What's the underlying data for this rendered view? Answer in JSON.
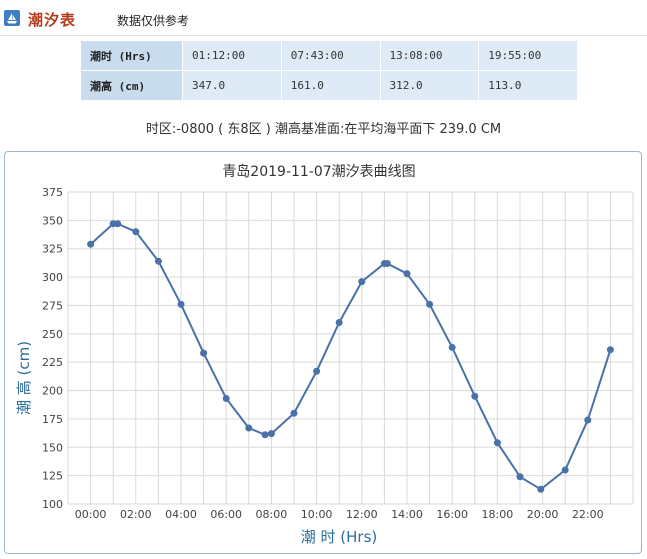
{
  "header": {
    "icon": "ship-icon",
    "title": "潮汐表",
    "note": "数据仅供参考"
  },
  "table": {
    "rows": [
      {
        "label": "潮时 (Hrs)",
        "values": [
          "01:12:00",
          "07:43:00",
          "13:08:00",
          "19:55:00"
        ]
      },
      {
        "label": "潮高 (cm)",
        "values": [
          "347.0",
          "161.0",
          "312.0",
          "113.0"
        ]
      }
    ]
  },
  "info": "时区:-0800 ( 东8区 ) 潮高基准面:在平均海平面下 239.0 CM",
  "colors": {
    "line": "#4a72a8",
    "grid": "#d9d9d9",
    "table_header": "#c9dcee",
    "table_cell": "#deebf7",
    "title_red": "#b63a1c",
    "axis_title": "#2d6e9e"
  },
  "chart_data": {
    "type": "line",
    "title": "青岛2019-11-07潮汐表曲线图",
    "xlabel": "潮 时 (Hrs)",
    "ylabel": "潮 高 (cm)",
    "ylim": [
      100,
      375
    ],
    "yticks": [
      100,
      125,
      150,
      175,
      200,
      225,
      250,
      275,
      300,
      325,
      350,
      375
    ],
    "xlim": [
      -1,
      24
    ],
    "xticks": [
      0,
      2,
      4,
      6,
      8,
      10,
      12,
      14,
      16,
      18,
      20,
      22
    ],
    "xtick_labels": [
      "00:00",
      "02:00",
      "04:00",
      "06:00",
      "08:00",
      "10:00",
      "12:00",
      "14:00",
      "16:00",
      "18:00",
      "20:00",
      "22:00"
    ],
    "grid": true,
    "legend": "none",
    "series": [
      {
        "x": [
          0,
          1,
          1.2,
          2,
          3,
          4,
          5,
          6,
          7,
          7.72,
          8,
          9,
          10,
          11,
          12,
          13,
          13.13,
          14,
          15,
          16,
          17,
          18,
          19,
          19.92,
          21,
          22,
          23
        ],
        "y": [
          329,
          347,
          347,
          340,
          314,
          276,
          233,
          193,
          167,
          161,
          162,
          180,
          217,
          260,
          296,
          312,
          312,
          303,
          276,
          238,
          195,
          154,
          124,
          113,
          130,
          174,
          236
        ]
      }
    ]
  }
}
